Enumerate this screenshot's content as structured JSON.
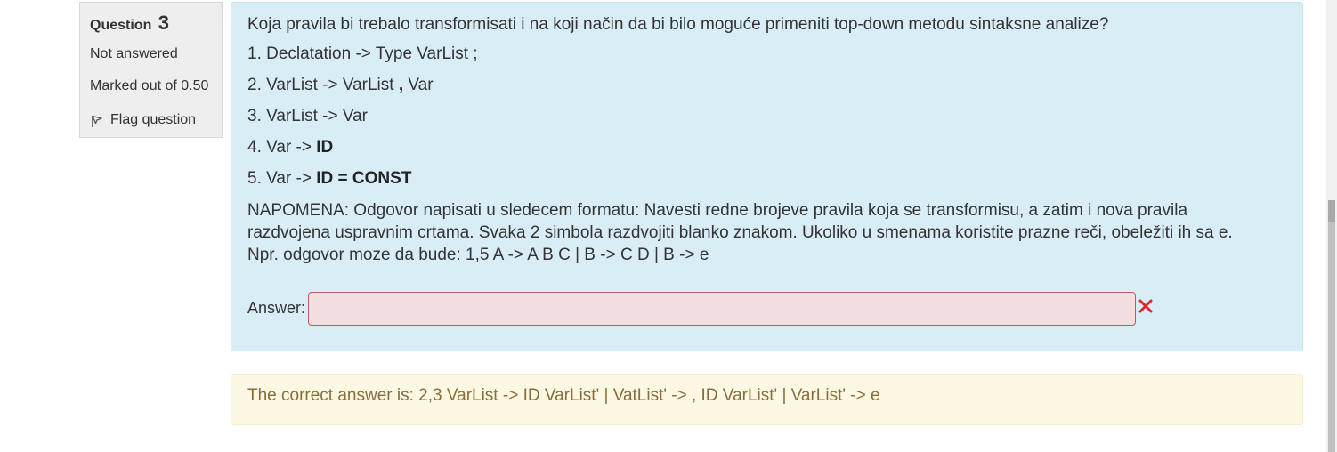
{
  "info": {
    "question_label": "Question",
    "question_number": "3",
    "state": "Not answered",
    "grade": "Marked out of 0.50",
    "flag_label": "Flag question"
  },
  "question": {
    "text": "Koja pravila bi trebalo transformisati i na koji način da bi bilo moguće primeniti top-down metodu sintaksne analize?",
    "rules": [
      {
        "prefix": "1. Declatation -> Type VarList ;",
        "bold": ""
      },
      {
        "prefix": "2. VarList -> VarList ",
        "bold": ",",
        "suffix": " Var"
      },
      {
        "prefix": "3. VarList -> Var",
        "bold": ""
      },
      {
        "prefix": "4. Var -> ",
        "bold": "ID"
      },
      {
        "prefix": "5. Var -> ",
        "bold": "ID = CONST"
      }
    ],
    "note": "NAPOMENA: Odgovor napisati u sledecem formatu: Navesti redne brojeve pravila koja se transformisu, a zatim i nova pravila razdvojena uspravnim crtama. Svaka 2 simbola razdvojiti blanko znakom. Ukoliko u smenama koristite prazne reči, obeležiti ih sa e. Npr. odgovor moze da bude: 1,5 A -> A B C | B -> C D | B -> e",
    "answer_label": "Answer:",
    "answer_value": ""
  },
  "feedback": {
    "text": "The correct answer is: 2,3 VarList -> ID VarList' | VatList' -> , ID VarList' | VarList' -> e"
  },
  "colors": {
    "content_bg": "#d9edf7",
    "feedback_bg": "#fcf8e3",
    "input_error_bg": "#f2dede",
    "wrong_icon": "#e0262a"
  },
  "icons": {
    "flag": "flag-icon",
    "wrong": "cross-icon"
  }
}
